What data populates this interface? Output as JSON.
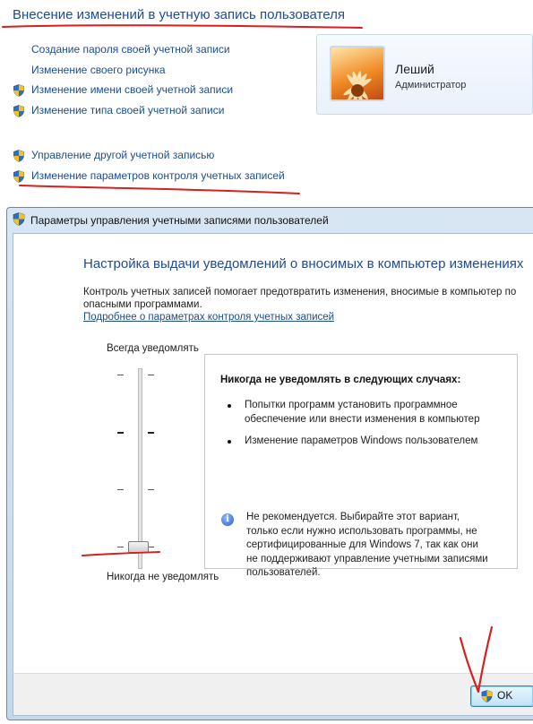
{
  "page": {
    "title": "Внесение изменений в учетную запись пользователя",
    "links": [
      {
        "label": "Создание пароля своей учетной записи",
        "shield": false
      },
      {
        "label": "Изменение своего рисунка",
        "shield": false
      },
      {
        "label": "Изменение имени своей учетной записи",
        "shield": true
      },
      {
        "label": "Изменение типа своей учетной записи",
        "shield": true
      },
      {
        "label": "Управление другой учетной записью",
        "shield": true
      },
      {
        "label": "Изменение параметров контроля учетных записей",
        "shield": true
      }
    ],
    "user": {
      "name": "Леший",
      "role": "Администратор"
    }
  },
  "dialog": {
    "title": "Параметры управления учетными записями пользователей",
    "heading": "Настройка выдачи уведомлений о вносимых в компьютер изменениях",
    "description_line1": "Контроль учетных записей помогает предотвратить изменения, вносимые в компьютер по",
    "description_line2": "опасными программами.",
    "more_link": "Подробнее о параметрах контроля учетных записей",
    "slider": {
      "top_label": "Всегда уведомлять",
      "bottom_label": "Никогда не уведомлять",
      "levels": 4,
      "selected_level": 1
    },
    "info": {
      "title": "Никогда не уведомлять в следующих случаях:",
      "bullets": [
        [
          "Попытки программ установить программное",
          "обеспечение или внести изменения в компьютер"
        ],
        [
          "Изменение параметров Windows пользователем"
        ]
      ],
      "warning": [
        "Не рекомендуется. Выбирайте этот вариант,",
        "только если нужно использовать программы, не",
        "сертифицированные для Windows 7, так как они",
        "не поддерживают управление учетными записями",
        "пользователей."
      ]
    },
    "ok_label": "OK"
  },
  "colors": {
    "link": "#1a4d8f",
    "heading": "#1e4b94",
    "annotation": "#d81e1e"
  },
  "icons": [
    "shield-icon",
    "user-avatar",
    "info-icon",
    "dialog-shield-icon"
  ]
}
